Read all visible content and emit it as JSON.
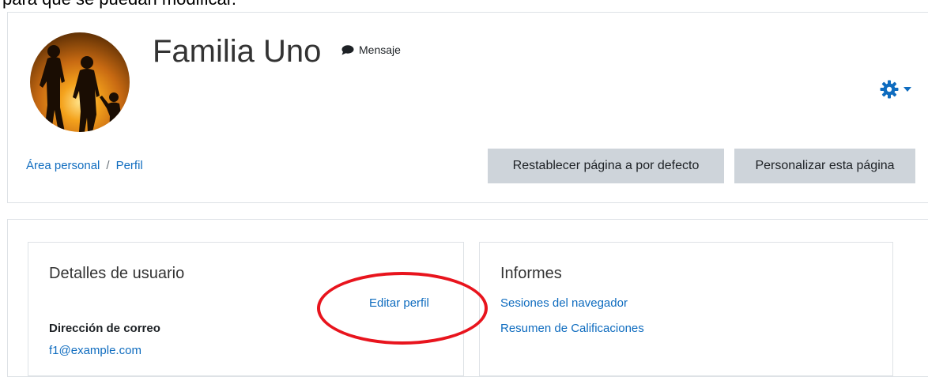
{
  "document": {
    "text_above": "para que se puedan modificar."
  },
  "profile": {
    "name": "Familia Uno",
    "message_label": "Mensaje"
  },
  "breadcrumb": {
    "items": [
      "Área personal",
      "Perfil"
    ],
    "separator": "/"
  },
  "page_actions": {
    "reset_label": "Restablecer página a por defecto",
    "customize_label": "Personalizar esta página"
  },
  "user_details": {
    "title": "Detalles de usuario",
    "edit_profile_label": "Editar perfil",
    "email_heading": "Dirección de correo",
    "email_value": "f1@example.com"
  },
  "reports": {
    "title": "Informes",
    "links": [
      "Sesiones del navegador",
      "Resumen de Calificaciones"
    ]
  },
  "icons": {
    "message": "speech-bubble-icon",
    "settings": "gear-icon",
    "settings_caret": "caret-down-icon"
  },
  "colors": {
    "link": "#0f6cbf",
    "button_bg": "#ced4da",
    "annotation": "#e8141d"
  }
}
